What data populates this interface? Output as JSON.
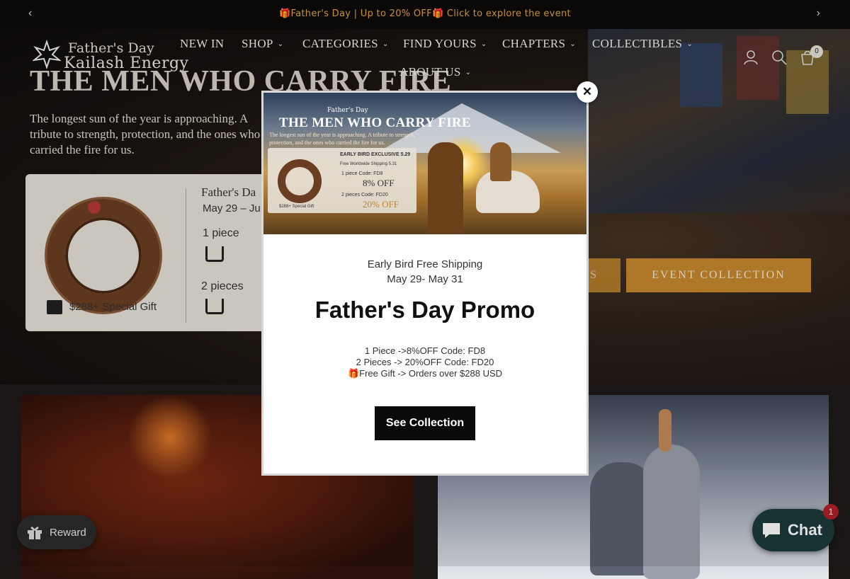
{
  "announcement": {
    "text": "🎁Father's Day | Up to 20% OFF🎁 Click to explore the event",
    "prev_icon": "chevron-left",
    "next_icon": "chevron-right"
  },
  "brand": {
    "tagline": "Father's Day",
    "name": "Kailash Energy"
  },
  "nav": {
    "items": [
      {
        "label": "NEW IN",
        "has_dropdown": false
      },
      {
        "label": "SHOP",
        "has_dropdown": true
      },
      {
        "label": "CATEGORIES",
        "has_dropdown": true
      },
      {
        "label": "FIND YOURS",
        "has_dropdown": true
      },
      {
        "label": "CHAPTERS",
        "has_dropdown": true
      },
      {
        "label": "COLLECTIBLES",
        "has_dropdown": true
      },
      {
        "label": "ABOUT US",
        "has_dropdown": true
      }
    ],
    "chevron": "⌄",
    "cart_count": "0"
  },
  "hero": {
    "headline": "THE MEN WHO CARRY FIRE",
    "subline": "The longest sun of the year is approaching. A tribute to strength, protection, and the ones who carried the fire for us.",
    "card": {
      "title": "Father's Da",
      "date": "May 29 – Ju",
      "one_piece": "1 piece",
      "two_pieces": "2 pieces",
      "gift": "$288+ Special Gift"
    },
    "button_partial": "S",
    "button_event": "EVENT COLLECTION"
  },
  "modal": {
    "image": {
      "fd": "Father's Day",
      "title": "THE MEN WHO CARRY FIRE",
      "desc": "The longest sun of the year is approaching. A tribute to strength, protection, and the ones who carried the fire for us.",
      "exclusive": "EARLY BIRD EXCLUSIVE  5.29",
      "free_ship": "Free Worldwide Shipping  5.31",
      "piece1": "1 piece  Code: FD8",
      "off8": "8% OFF",
      "piece2": "2 pieces  Code: FD20",
      "off20": "20% OFF",
      "gift": "$288+ Special Gift"
    },
    "shipping_line1": "Early Bird Free Shipping",
    "shipping_line2": "May 29- May 31",
    "title": "Father's Day Promo",
    "detail_line1": "1 Piece ->8%OFF Code: FD8",
    "detail_line2": "2 Pieces -> 20%OFF Code: FD20",
    "detail_line3": "🎁Free Gift -> Orders over $288 USD",
    "cta": "See Collection",
    "close": "✕"
  },
  "widgets": {
    "reward_label": "Reward",
    "chat_label": "Chat",
    "chat_badge": "1"
  },
  "colors": {
    "accent_gold": "#c8892e",
    "announcement_text": "#e5a33a",
    "chat_bg": "#1d3b3d",
    "badge_red": "#b0212a"
  }
}
